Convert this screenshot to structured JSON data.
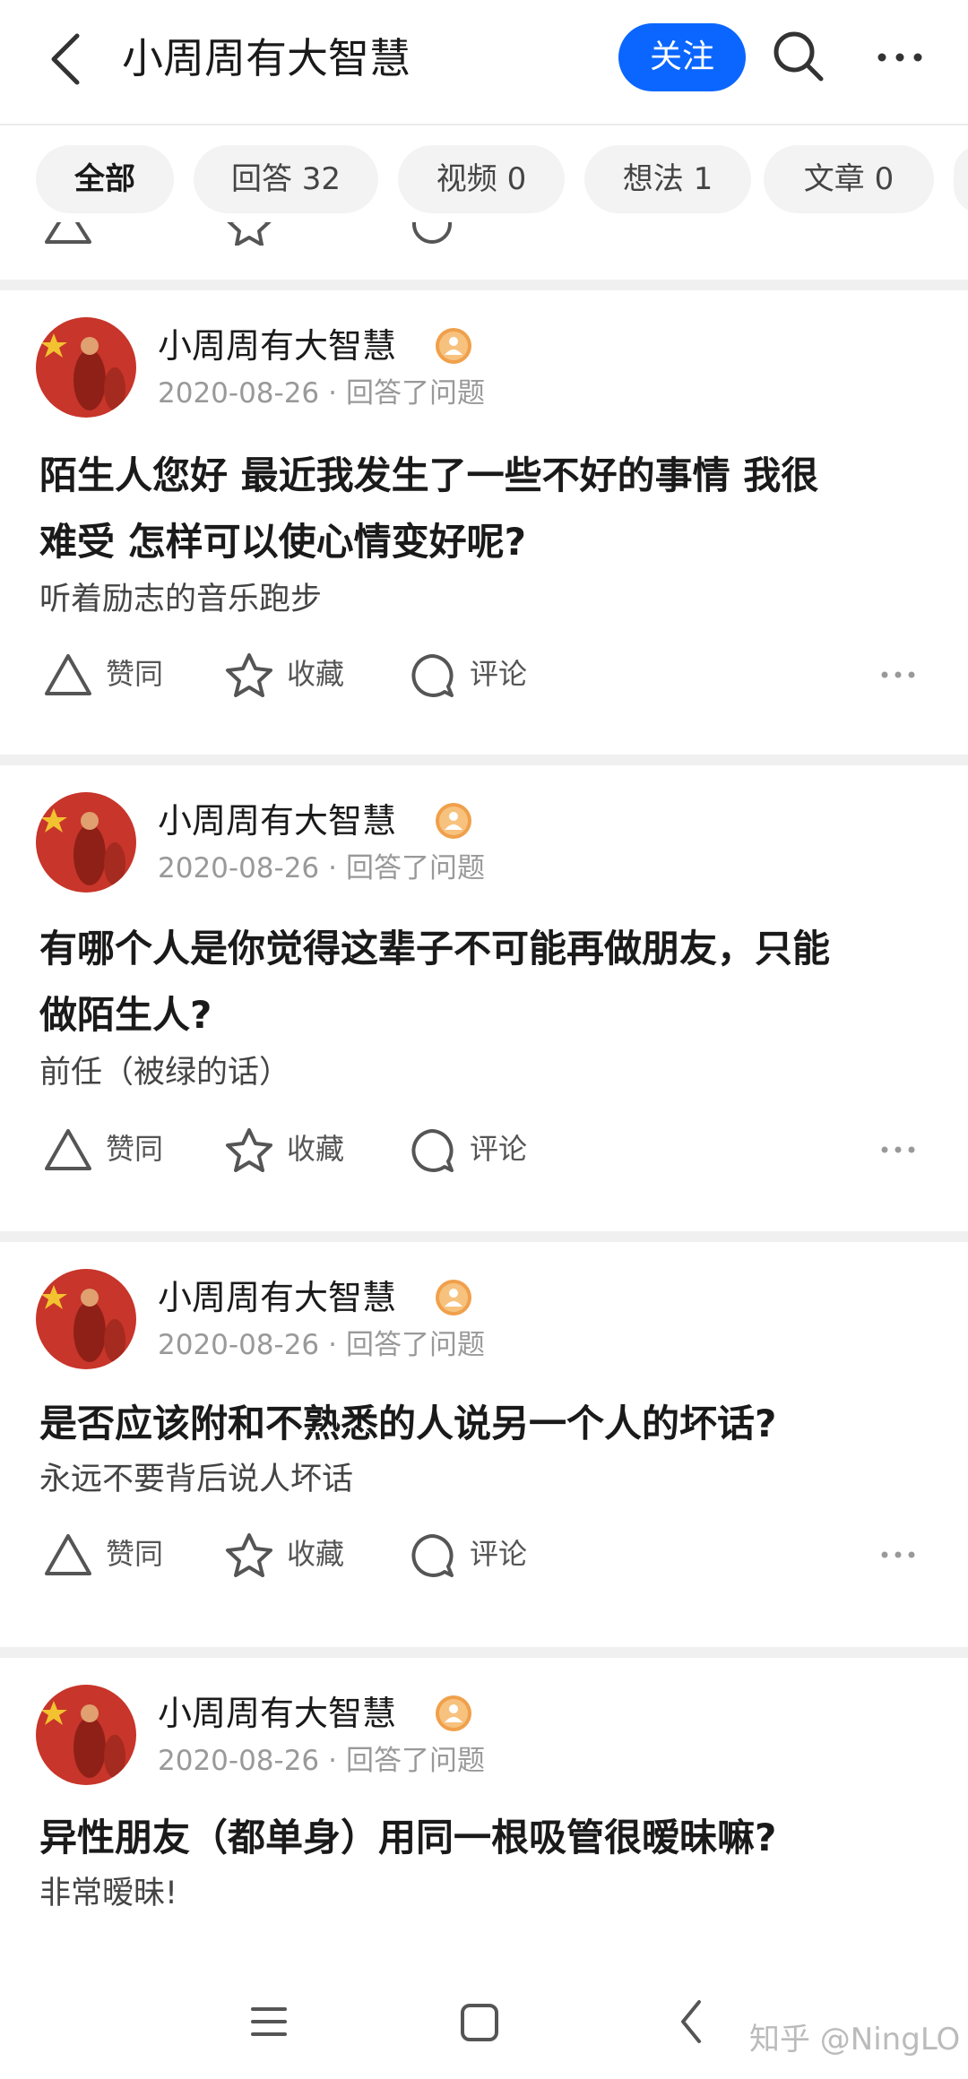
{
  "header": {
    "title": "小周周有大智慧",
    "follow_label": "关注"
  },
  "tabs": [
    {
      "label": "全部"
    },
    {
      "label": "回答 32"
    },
    {
      "label": "视频 0"
    },
    {
      "label": "想法 1"
    },
    {
      "label": "文章 0"
    }
  ],
  "action_labels": {
    "upvote": "赞同",
    "collect": "收藏",
    "comment": "评论"
  },
  "feed": [
    {
      "author": "小周周有大智慧",
      "date": "2020-08-26",
      "separator": "·",
      "action": "回答了问题",
      "question_line1": "陌生人您好 最近我发生了一些不好的事情 我很",
      "question_line2": "难受 怎样可以使心情变好呢?",
      "excerpt": "听着励志的音乐跑步"
    },
    {
      "author": "小周周有大智慧",
      "date": "2020-08-26",
      "separator": "·",
      "action": "回答了问题",
      "question_line1": "有哪个人是你觉得这辈子不可能再做朋友，只能",
      "question_line2": "做陌生人?",
      "excerpt": "前任（被绿的话）"
    },
    {
      "author": "小周周有大智慧",
      "date": "2020-08-26",
      "separator": "·",
      "action": "回答了问题",
      "question_line1": "是否应该附和不熟悉的人说另一个人的坏话?",
      "excerpt": "永远不要背后说人坏话"
    },
    {
      "author": "小周周有大智慧",
      "date": "2020-08-26",
      "separator": "·",
      "action": "回答了问题",
      "question_line1": "异性朋友（都单身）用同一根吸管很暧昧嘛?",
      "excerpt": "非常暧昧!"
    }
  ],
  "watermark": "知乎 @NingLO",
  "colors": {
    "accent": "#0a66ff",
    "badge": "#f0a04b",
    "avatar_red": "#c8352a",
    "avatar_yellow": "#f2c230"
  },
  "icons": [
    "back-arrow-icon",
    "search-icon",
    "more-icon",
    "upvote-triangle-icon",
    "star-icon",
    "comment-bubble-icon",
    "user-badge-icon",
    "menu-icon",
    "home-square-icon",
    "nav-back-icon"
  ]
}
